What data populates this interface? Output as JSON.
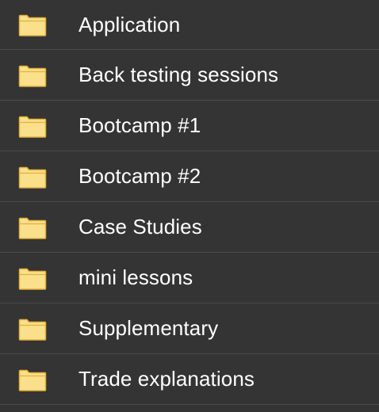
{
  "folders": [
    {
      "name": "Application",
      "icon": "folder-icon"
    },
    {
      "name": "Back testing sessions",
      "icon": "folder-icon"
    },
    {
      "name": "Bootcamp #1",
      "icon": "folder-icon"
    },
    {
      "name": "Bootcamp #2",
      "icon": "folder-icon"
    },
    {
      "name": "Case Studies",
      "icon": "folder-icon"
    },
    {
      "name": "mini lessons",
      "icon": "folder-icon"
    },
    {
      "name": "Supplementary",
      "icon": "folder-icon"
    },
    {
      "name": "Trade explanations",
      "icon": "folder-icon"
    }
  ],
  "colors": {
    "background": "#343435",
    "divider": "#4a4a4c",
    "text": "#ffffff",
    "folder_fill": "#fbe08c",
    "folder_outline": "#e2b13c"
  }
}
